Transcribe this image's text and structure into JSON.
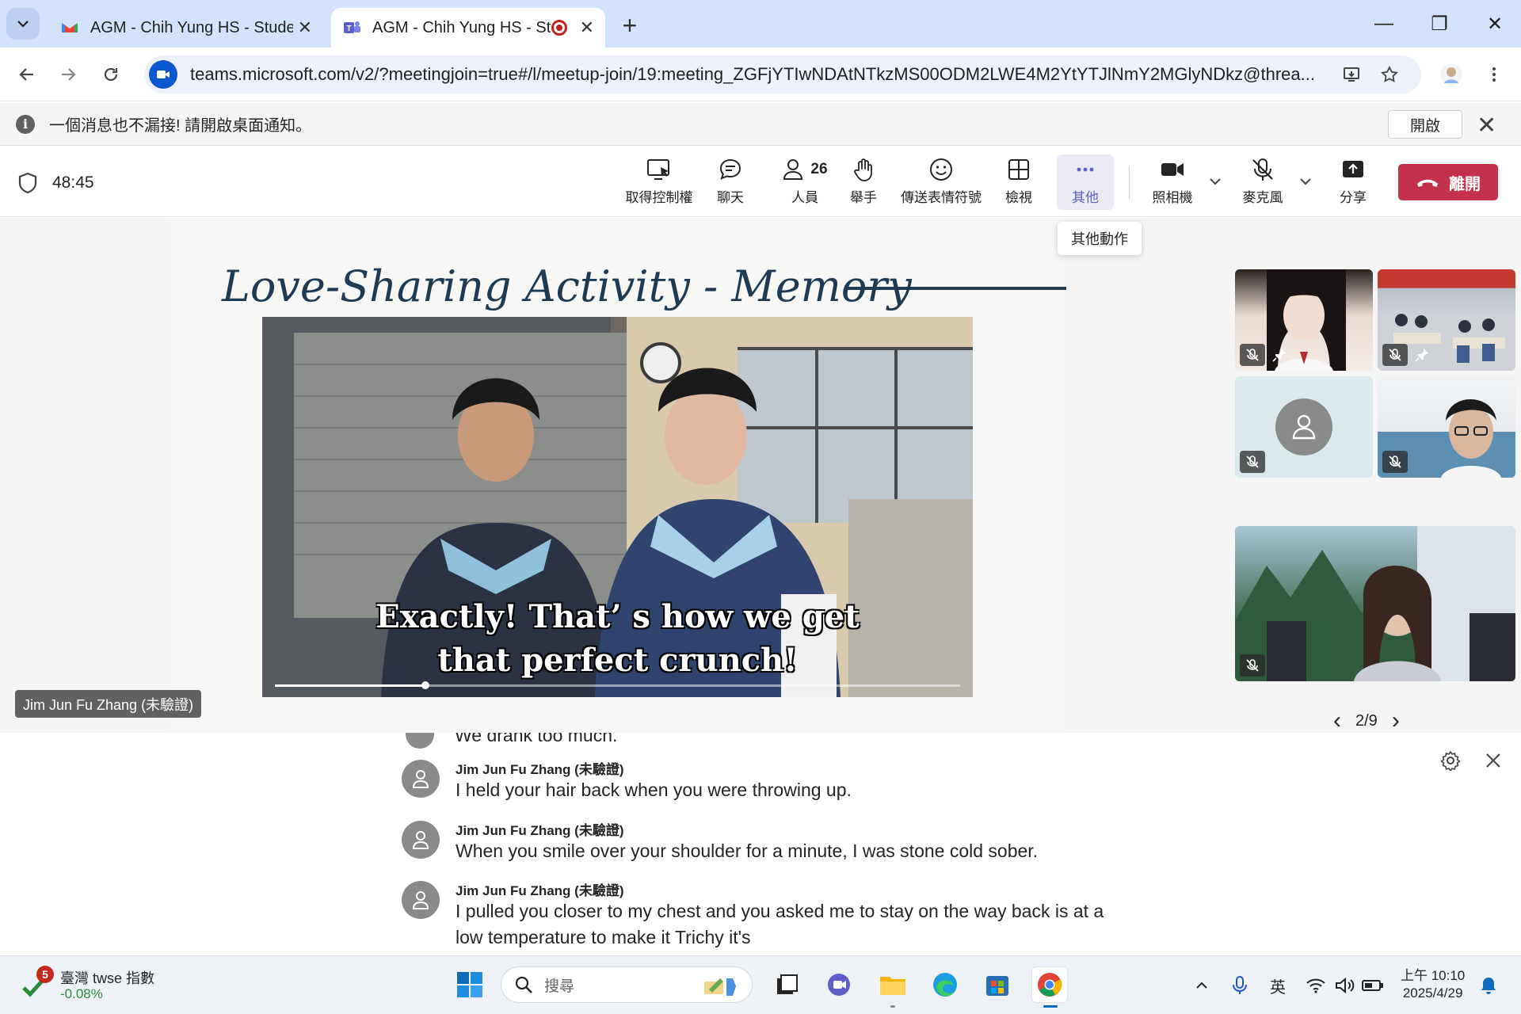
{
  "browser": {
    "tabs": [
      {
        "title": "AGM - Chih Yung HS - Studen",
        "active": false
      },
      {
        "title": "AGM - Chih Yung HS - Stu",
        "active": true
      }
    ],
    "new_tab": "+",
    "url": "teams.microsoft.com/v2/?meetingjoin=true#/l/meetup-join/19:meeting_ZGFjYTIwNDAtNTkzMS00ODM2LWE4M2YtYTJlNmY2MGlyNDkz@threa...",
    "window": {
      "minimize": "—",
      "restore": "❐",
      "close": "✕"
    }
  },
  "notification": {
    "message": "一個消息也不漏接! 請開啟桌面通知。",
    "open_label": "開啟",
    "close": "✕",
    "info": "i"
  },
  "meeting": {
    "timer": "48:45",
    "controls": {
      "take_control": "取得控制權",
      "chat": "聊天",
      "people": "人員",
      "people_count": "26",
      "raise_hand": "舉手",
      "reactions": "傳送表情符號",
      "view": "檢視",
      "more": "其他",
      "camera": "照相機",
      "mic": "麥克風",
      "share": "分享",
      "leave": "離開"
    },
    "tooltip": "其他動作"
  },
  "slide": {
    "title": "Love-Sharing Activity - Memory",
    "subtitle_line1": "Exactly! That’  s how we get",
    "subtitle_line2": "that perfect crunch!",
    "video_progress": 0.22
  },
  "presenter_name": "Jim Jun Fu Zhang (未驗證)",
  "gallery": {
    "pager": "2/9",
    "prev": "‹",
    "next": "›"
  },
  "captions": {
    "partial_top": "We drank too much.",
    "items": [
      {
        "speaker": "Jim Jun Fu Zhang (未驗證)",
        "text": "I held your hair back when you were throwing up."
      },
      {
        "speaker": "Jim Jun Fu Zhang (未驗證)",
        "text": "When you smile over your shoulder for a minute, I was stone cold sober."
      },
      {
        "speaker": "Jim Jun Fu Zhang (未驗證)",
        "text": "I pulled you closer to my chest and you asked me to stay on the way back is at a low temperature to make it Trichy it's"
      }
    ]
  },
  "taskbar": {
    "widget": {
      "badge": "5",
      "title": "臺灣 twse 指數",
      "change": "-0.08%"
    },
    "search_placeholder": "搜尋",
    "tray": {
      "ime": "英",
      "chevron": "^"
    },
    "clock": {
      "time": "上午 10:10",
      "date": "2025/4/29"
    }
  },
  "colors": {
    "tabstrip": "#d3e3fd",
    "teams_purple": "#5b5fc7",
    "leave_red": "#c4314b",
    "slide_title": "#1f3b54"
  }
}
